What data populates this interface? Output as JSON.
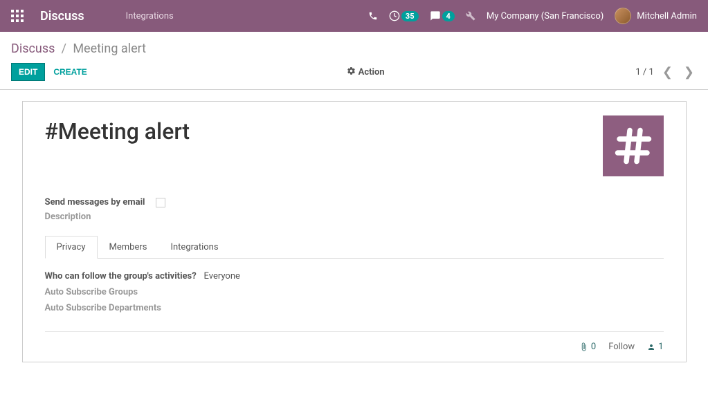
{
  "navbar": {
    "brand": "Discuss",
    "menu_integrations": "Integrations",
    "activity_badge": "35",
    "messaging_badge": "4",
    "company": "My Company (San Francisco)",
    "user": "Mitchell Admin"
  },
  "breadcrumb": {
    "root": "Discuss",
    "current": "Meeting alert"
  },
  "controls": {
    "edit": "Edit",
    "create": "Create",
    "action": "Action",
    "pager": "1 / 1"
  },
  "form": {
    "title_prefix": "#",
    "title": "Meeting alert",
    "send_email_label": "Send messages by email",
    "description_label": "Description",
    "tabs": {
      "privacy": "Privacy",
      "members": "Members",
      "integrations": "Integrations"
    },
    "privacy": {
      "who_label": "Who can follow the group's activities?",
      "who_value": "Everyone",
      "auto_groups_label": "Auto Subscribe Groups",
      "auto_dept_label": "Auto Subscribe Departments"
    },
    "follow": {
      "attachments": "0",
      "follow_label": "Follow",
      "followers": "1"
    }
  }
}
